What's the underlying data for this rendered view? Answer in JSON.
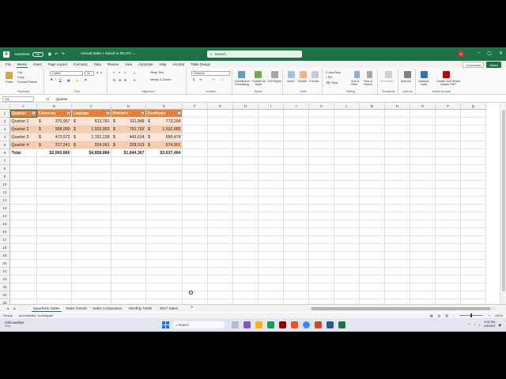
{
  "titlebar": {
    "autosave_label": "AutoSave",
    "autosave_state": "Off",
    "doc_title": "Annual Sales • Saved to this PC ⌄",
    "search_placeholder": "Search",
    "avatar_initial": "R",
    "app_letter": "X"
  },
  "menu": {
    "tabs": [
      "File",
      "Home",
      "Insert",
      "Page Layout",
      "Formulas",
      "Data",
      "Review",
      "View",
      "Automate",
      "Help",
      "Acrobat",
      "Table Design"
    ],
    "active": "Home",
    "comments_label": "Comments",
    "share_label": "Share"
  },
  "ribbon": {
    "paste": "Paste",
    "cut": "Cut",
    "copy": "Copy",
    "format_painter": "Format Painter",
    "clipboard_group": "Clipboard",
    "font_name": "Calibri",
    "font_size": "11",
    "font_group": "Font",
    "wrap_text": "Wrap Text",
    "merge_center": "Merge & Center",
    "alignment_group": "Alignment",
    "number_format": "General",
    "number_group": "Number",
    "conditional_formatting": "Conditional Formatting",
    "format_as_table": "Format as Table",
    "cell_styles": "Cell Styles",
    "styles_group": "Styles",
    "insert": "Insert",
    "delete": "Delete",
    "format": "Format",
    "cells_group": "Cells",
    "autosum": "AutoSum",
    "fill": "Fill",
    "clear": "Clear",
    "sort_filter": "Sort & Filter",
    "find_select": "Find & Select",
    "editing_group": "Editing",
    "sensitivity": "Sensitivity",
    "sensitivity_group": "Sensitivity",
    "addins": "Add-ins",
    "addins_group": "Add-ins",
    "analyze_data": "Analyze Data",
    "create_share_pdf": "Create and Share Adobe PDF",
    "acrobat_group": "Adobe Acrobat"
  },
  "formula": {
    "namebox": "A1",
    "fx": "fx",
    "content": "Quarter"
  },
  "grid": {
    "columns": [
      "A",
      "B",
      "C",
      "D",
      "E",
      "F",
      "G",
      "H",
      "I",
      "J",
      "K",
      "L",
      "M",
      "N",
      "O",
      "P",
      "Q"
    ],
    "rows": [
      "1",
      "2",
      "3",
      "4",
      "5",
      "6",
      "7",
      "8",
      "9",
      "10",
      "11",
      "12",
      "13",
      "14",
      "15",
      "16",
      "17",
      "18",
      "19",
      "20",
      "21",
      "22",
      "23",
      "24",
      "25"
    ],
    "headers": [
      "Quarter",
      "Cameras",
      "Laptops",
      "Printers",
      "Desktops"
    ],
    "data": [
      [
        "Quarter 1",
        "370,957",
        "813,781",
        "311,948",
        "773,204"
      ],
      [
        "Quarter 2",
        "908,090",
        "1,929,903",
        "761,792",
        "1,532,885"
      ],
      [
        "Quarter 3",
        "473,572",
        "1,191,139",
        "442,614",
        "656,474"
      ],
      [
        "Quarter 4",
        "317,241",
        "924,061",
        "328,013",
        "674,901"
      ]
    ],
    "currency": "$",
    "total_label": "Total",
    "totals": [
      "$2,069,860",
      "$4,858,884",
      "$1,844,367",
      "$3,637,464"
    ]
  },
  "sheets": {
    "tabs": [
      "Quarterly Sales",
      "Sales Trends",
      "Sales Comparison",
      "Monthly Totals",
      "2017 Sales"
    ],
    "active": "Quarterly Sales",
    "add": "+"
  },
  "status": {
    "ready": "Ready",
    "accessibility": "Accessibility: Investigate",
    "zoom": "100%"
  },
  "taskbar": {
    "weather_title": "Cold weather",
    "weather_sub": "Now",
    "search_placeholder": "Search",
    "time": "2:06 PM",
    "date": "1/8/2025"
  },
  "colors": {
    "excel_green": "#1e7145",
    "table_header": "#ed7d31",
    "band_light": "#fbe4d5",
    "band_dark": "#f8cbad"
  }
}
